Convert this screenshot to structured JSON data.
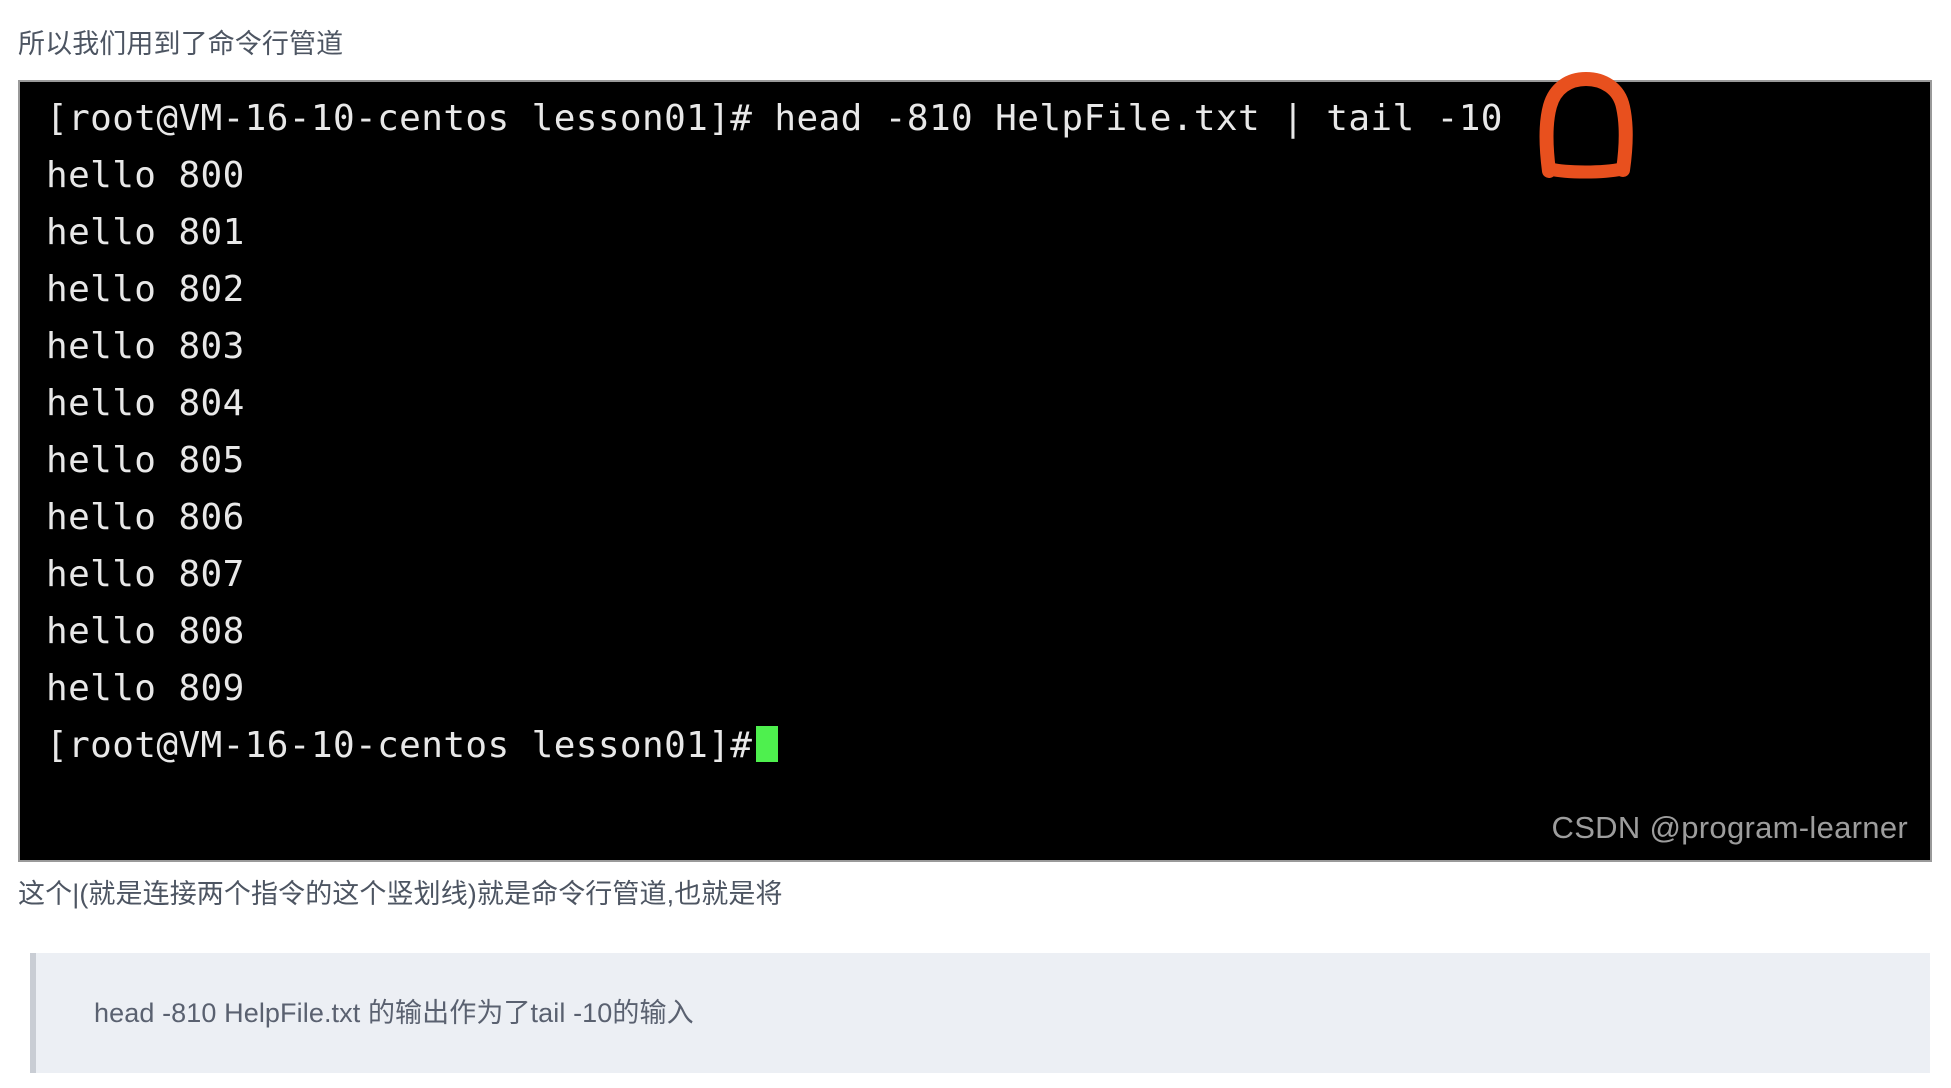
{
  "page": {
    "background_color": "#ffffff",
    "intro_text": "所以我们用到了命令行管道",
    "explanation_text": "这个|(就是连接两个指令的这个竖划线)就是命令行管道,也就是将"
  },
  "terminal": {
    "background_color": "#000000",
    "text_color": "#e8e8e8",
    "border_color": "#9a9a9a",
    "cursor_color": "#4ef04e",
    "prompt": "[root@VM-16-10-centos lesson01]#",
    "command": "head -810 HelpFile.txt | tail -10",
    "command_line": "[root@VM-16-10-centos lesson01]# head -810 HelpFile.txt | tail -10",
    "output_lines": [
      "hello 800",
      "hello 801",
      "hello 802",
      "hello 803",
      "hello 804",
      "hello 805",
      "hello 806",
      "hello 807",
      "hello 808",
      "hello 809"
    ],
    "final_prompt": "[root@VM-16-10-centos lesson01]#",
    "watermark": "CSDN @program-learner"
  },
  "annotation": {
    "name": "pipe-highlight",
    "shape": "hand-drawn-rounded-rectangle",
    "color": "#e8501e",
    "targets_character": "|"
  },
  "quote": {
    "text": "head -810 HelpFile.txt 的输出作为了tail -10的输入",
    "background_color": "#eceff4",
    "border_color": "#c9cdd4"
  }
}
